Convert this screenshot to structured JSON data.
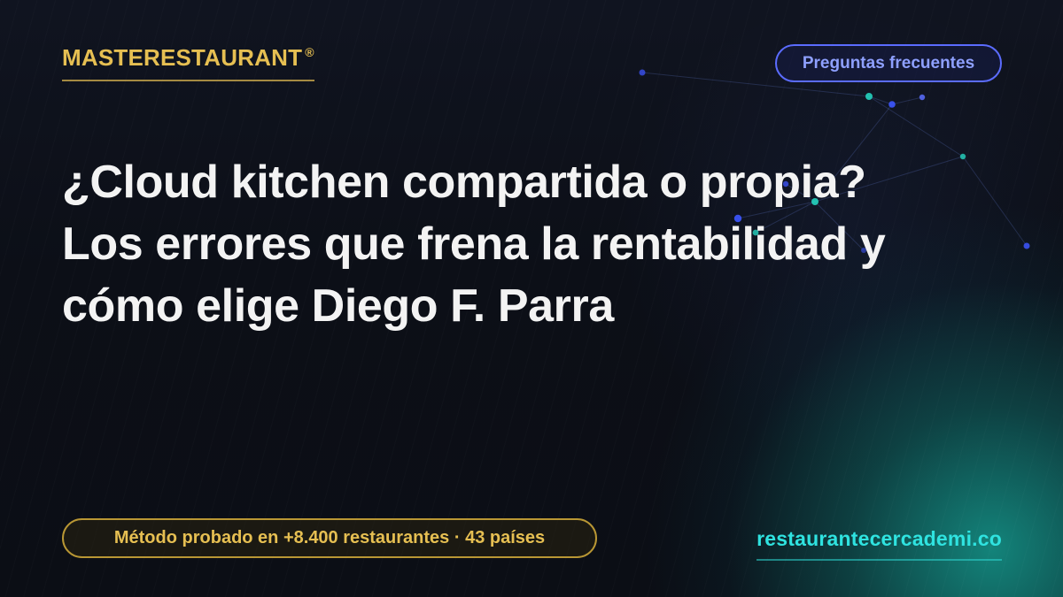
{
  "brand": {
    "name": "MASTERESTAURANT",
    "mark": "®"
  },
  "header": {
    "faq_label": "Preguntas frecuentes"
  },
  "headline": {
    "lines": [
      "¿Cloud kitchen compartida o propia?",
      "Los errores que frena la rentabilidad y",
      "cómo elige Diego F. Parra"
    ]
  },
  "footer": {
    "badge_text": "Método probado en +8.400 restaurantes · 43 países",
    "site_text": "restaurantecercademi.co"
  },
  "colors": {
    "background": "#0c0f17",
    "gold": "#e6bf52",
    "blue": "#5b6cff",
    "teal": "#2fe3e0",
    "text": "#f3f3f3"
  }
}
